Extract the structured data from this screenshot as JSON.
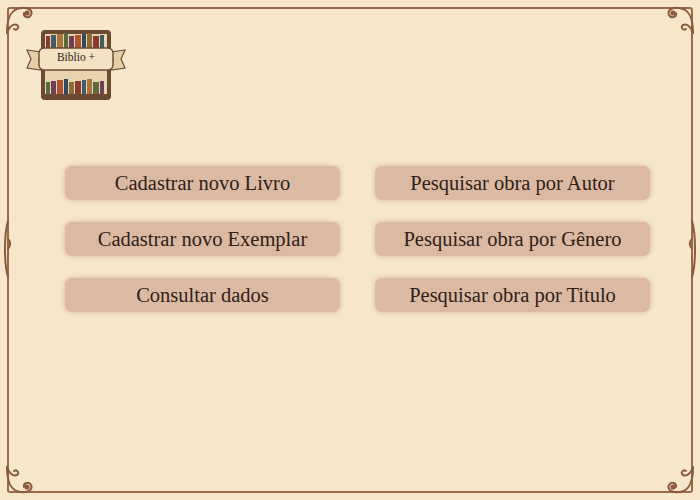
{
  "logo": {
    "text": "Biblio +"
  },
  "menu": {
    "left": [
      "Cadastrar novo Livro",
      "Cadastrar novo Exemplar",
      "Consultar dados"
    ],
    "right": [
      "Pesquisar obra por Autor",
      "Pesquisar obra por Gênero",
      "Pesquisar obra por Titulo"
    ]
  }
}
